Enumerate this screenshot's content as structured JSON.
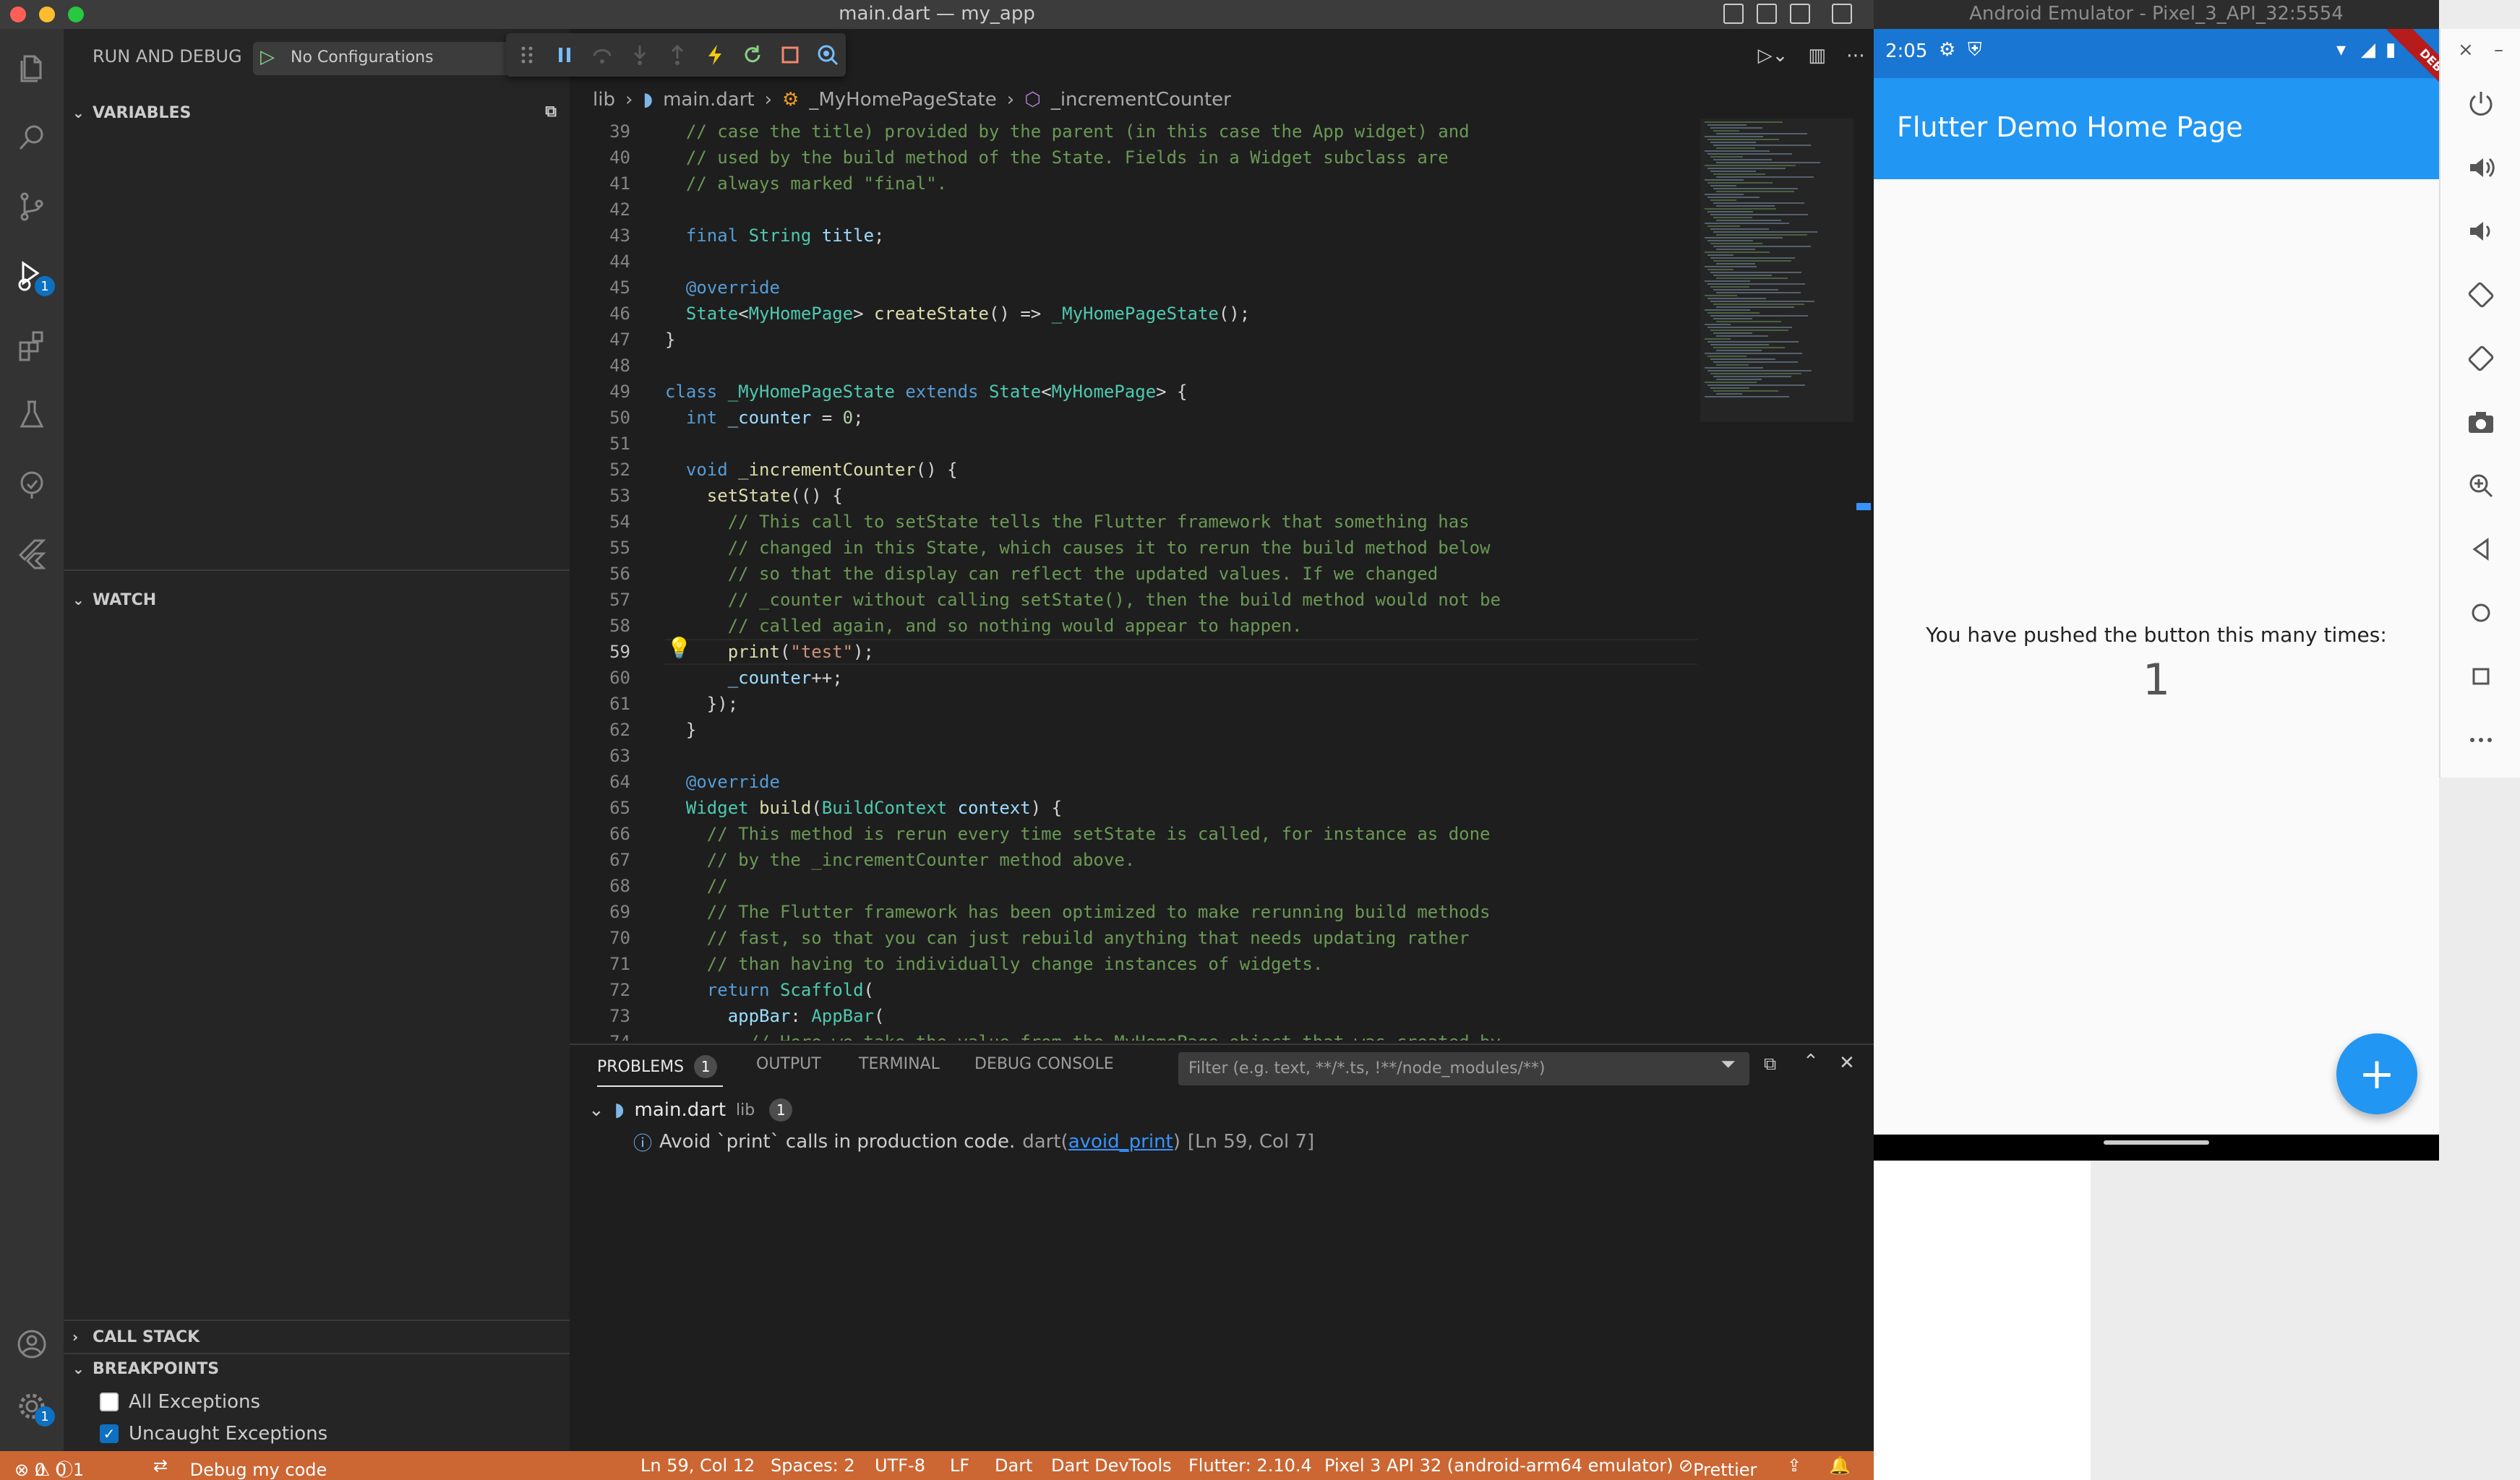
{
  "window": {
    "title": "main.dart — my_app"
  },
  "activity_bar": {
    "run_debug_badge": "1",
    "settings_badge": "1"
  },
  "sidebar": {
    "header": "RUN AND DEBUG",
    "config": "No Configurations",
    "sections": {
      "variables": "VARIABLES",
      "watch": "WATCH",
      "call_stack": "CALL STACK",
      "breakpoints": "BREAKPOINTS"
    },
    "breakpoints": [
      {
        "label": "All Exceptions",
        "checked": false
      },
      {
        "label": "Uncaught Exceptions",
        "checked": true
      }
    ]
  },
  "breadcrumb": [
    "lib",
    "main.dart",
    "_MyHomePageState",
    "_incrementCounter"
  ],
  "code_lines": [
    {
      "n": "39",
      "tokens": [
        [
          "c-com",
          "  // case the title) provided by the parent (in this case the App widget) and"
        ]
      ]
    },
    {
      "n": "40",
      "tokens": [
        [
          "c-com",
          "  // used by the build method of the State. Fields in a Widget subclass are"
        ]
      ]
    },
    {
      "n": "41",
      "tokens": [
        [
          "c-com",
          "  // always marked \"final\"."
        ]
      ]
    },
    {
      "n": "42",
      "tokens": []
    },
    {
      "n": "43",
      "tokens": [
        [
          "",
          "  "
        ],
        [
          "c-kw",
          "final"
        ],
        [
          "",
          " "
        ],
        [
          "c-type",
          "String"
        ],
        [
          "",
          " "
        ],
        [
          "c-var",
          "title"
        ],
        [
          "",
          ";"
        ]
      ]
    },
    {
      "n": "44",
      "tokens": []
    },
    {
      "n": "45",
      "tokens": [
        [
          "",
          "  "
        ],
        [
          "c-ann",
          "@override"
        ]
      ]
    },
    {
      "n": "46",
      "tokens": [
        [
          "",
          "  "
        ],
        [
          "c-type",
          "State"
        ],
        [
          "",
          "<"
        ],
        [
          "c-type",
          "MyHomePage"
        ],
        [
          "",
          "> "
        ],
        [
          "c-fn",
          "createState"
        ],
        [
          "",
          "() => "
        ],
        [
          "c-type",
          "_MyHomePageState"
        ],
        [
          "",
          "();"
        ]
      ]
    },
    {
      "n": "47",
      "tokens": [
        [
          "",
          "}"
        ]
      ]
    },
    {
      "n": "48",
      "tokens": []
    },
    {
      "n": "49",
      "tokens": [
        [
          "c-kw",
          "class"
        ],
        [
          "",
          " "
        ],
        [
          "c-type",
          "_MyHomePageState"
        ],
        [
          "",
          " "
        ],
        [
          "c-kw",
          "extends"
        ],
        [
          "",
          " "
        ],
        [
          "c-type",
          "State"
        ],
        [
          "",
          "<"
        ],
        [
          "c-type",
          "MyHomePage"
        ],
        [
          "",
          "> {"
        ]
      ]
    },
    {
      "n": "50",
      "tokens": [
        [
          "",
          "  "
        ],
        [
          "c-kw",
          "int"
        ],
        [
          "",
          " "
        ],
        [
          "c-var",
          "_counter"
        ],
        [
          "",
          " = "
        ],
        [
          "c-num",
          "0"
        ],
        [
          "",
          ";"
        ]
      ]
    },
    {
      "n": "51",
      "tokens": []
    },
    {
      "n": "52",
      "tokens": [
        [
          "",
          "  "
        ],
        [
          "c-kw",
          "void"
        ],
        [
          "",
          " "
        ],
        [
          "c-fn",
          "_incrementCounter"
        ],
        [
          "",
          "() {"
        ]
      ]
    },
    {
      "n": "53",
      "tokens": [
        [
          "",
          "    "
        ],
        [
          "c-fn",
          "setState"
        ],
        [
          "",
          "(() {"
        ]
      ]
    },
    {
      "n": "54",
      "tokens": [
        [
          "c-com",
          "      // This call to setState tells the Flutter framework that something has"
        ]
      ]
    },
    {
      "n": "55",
      "tokens": [
        [
          "c-com",
          "      // changed in this State, which causes it to rerun the build method below"
        ]
      ]
    },
    {
      "n": "56",
      "tokens": [
        [
          "c-com",
          "      // so that the display can reflect the updated values. If we changed"
        ]
      ]
    },
    {
      "n": "57",
      "tokens": [
        [
          "c-com",
          "      // _counter without calling setState(), then the build method would not be"
        ]
      ]
    },
    {
      "n": "58",
      "tokens": [
        [
          "c-com",
          "      // called again, and so nothing would appear to happen."
        ]
      ]
    },
    {
      "n": "59",
      "tokens": [
        [
          "",
          "      "
        ],
        [
          "c-fn",
          "print"
        ],
        [
          "",
          "("
        ],
        [
          "c-str",
          "\"test\""
        ],
        [
          "",
          ");"
        ]
      ]
    },
    {
      "n": "60",
      "tokens": [
        [
          "",
          "      "
        ],
        [
          "c-var",
          "_counter"
        ],
        [
          "",
          "++;"
        ]
      ]
    },
    {
      "n": "61",
      "tokens": [
        [
          "",
          "    });"
        ]
      ]
    },
    {
      "n": "62",
      "tokens": [
        [
          "",
          "  }"
        ]
      ]
    },
    {
      "n": "63",
      "tokens": []
    },
    {
      "n": "64",
      "tokens": [
        [
          "",
          "  "
        ],
        [
          "c-ann",
          "@override"
        ]
      ]
    },
    {
      "n": "65",
      "tokens": [
        [
          "",
          "  "
        ],
        [
          "c-type",
          "Widget"
        ],
        [
          "",
          " "
        ],
        [
          "c-fn",
          "build"
        ],
        [
          "",
          "("
        ],
        [
          "c-type",
          "BuildContext"
        ],
        [
          "",
          " "
        ],
        [
          "c-var",
          "context"
        ],
        [
          "",
          ") {"
        ]
      ]
    },
    {
      "n": "66",
      "tokens": [
        [
          "c-com",
          "    // This method is rerun every time setState is called, for instance as done"
        ]
      ]
    },
    {
      "n": "67",
      "tokens": [
        [
          "c-com",
          "    // by the _incrementCounter method above."
        ]
      ]
    },
    {
      "n": "68",
      "tokens": [
        [
          "c-com",
          "    //"
        ]
      ]
    },
    {
      "n": "69",
      "tokens": [
        [
          "c-com",
          "    // The Flutter framework has been optimized to make rerunning build methods"
        ]
      ]
    },
    {
      "n": "70",
      "tokens": [
        [
          "c-com",
          "    // fast, so that you can just rebuild anything that needs updating rather"
        ]
      ]
    },
    {
      "n": "71",
      "tokens": [
        [
          "c-com",
          "    // than having to individually change instances of widgets."
        ]
      ]
    },
    {
      "n": "72",
      "tokens": [
        [
          "",
          "    "
        ],
        [
          "c-kw",
          "return"
        ],
        [
          "",
          " "
        ],
        [
          "c-type",
          "Scaffold"
        ],
        [
          "",
          "("
        ]
      ]
    },
    {
      "n": "73",
      "tokens": [
        [
          "",
          "      "
        ],
        [
          "c-var",
          "appBar"
        ],
        [
          "",
          ": "
        ],
        [
          "c-type",
          "AppBar"
        ],
        [
          "",
          "("
        ]
      ]
    },
    {
      "n": "74",
      "tokens": [
        [
          "c-com",
          "        // Here we take the value from the MyHomePage object that was created by"
        ]
      ]
    }
  ],
  "current_line": "59",
  "panel": {
    "tabs": [
      "PROBLEMS",
      "OUTPUT",
      "TERMINAL",
      "DEBUG CONSOLE"
    ],
    "problems_count": "1",
    "filter_placeholder": "Filter (e.g. text, **/*.ts, !**/node_modules/**)",
    "file": {
      "name": "main.dart",
      "folder": "lib",
      "count": "1"
    },
    "problem": {
      "message": "Avoid `print` calls in production code.",
      "source": "dart",
      "code": "avoid_print",
      "location": "[Ln 59, Col 7]"
    }
  },
  "statusbar": {
    "errors": "0",
    "warnings": "0",
    "infos": "1",
    "debug": "Debug my code",
    "position": "Ln 59, Col 12",
    "spaces": "Spaces: 2",
    "encoding": "UTF-8",
    "eol": "LF",
    "language": "Dart",
    "devtools": "Dart DevTools",
    "flutter": "Flutter: 2.10.4",
    "device": "Pixel 3 API 32 (android-arm64 emulator)",
    "prettier": "Prettier"
  },
  "emulator": {
    "title": "Android Emulator - Pixel_3_API_32:5554",
    "time": "2:05",
    "app_title": "Flutter Demo Home Page",
    "debug_label": "DEBUG",
    "body_text": "You have pushed the button this many times:",
    "counter": "1",
    "fab": "+"
  },
  "colors": {
    "statusbar": "#cc6633",
    "appbar": "#2196f3",
    "accent": "#0e70c0"
  }
}
